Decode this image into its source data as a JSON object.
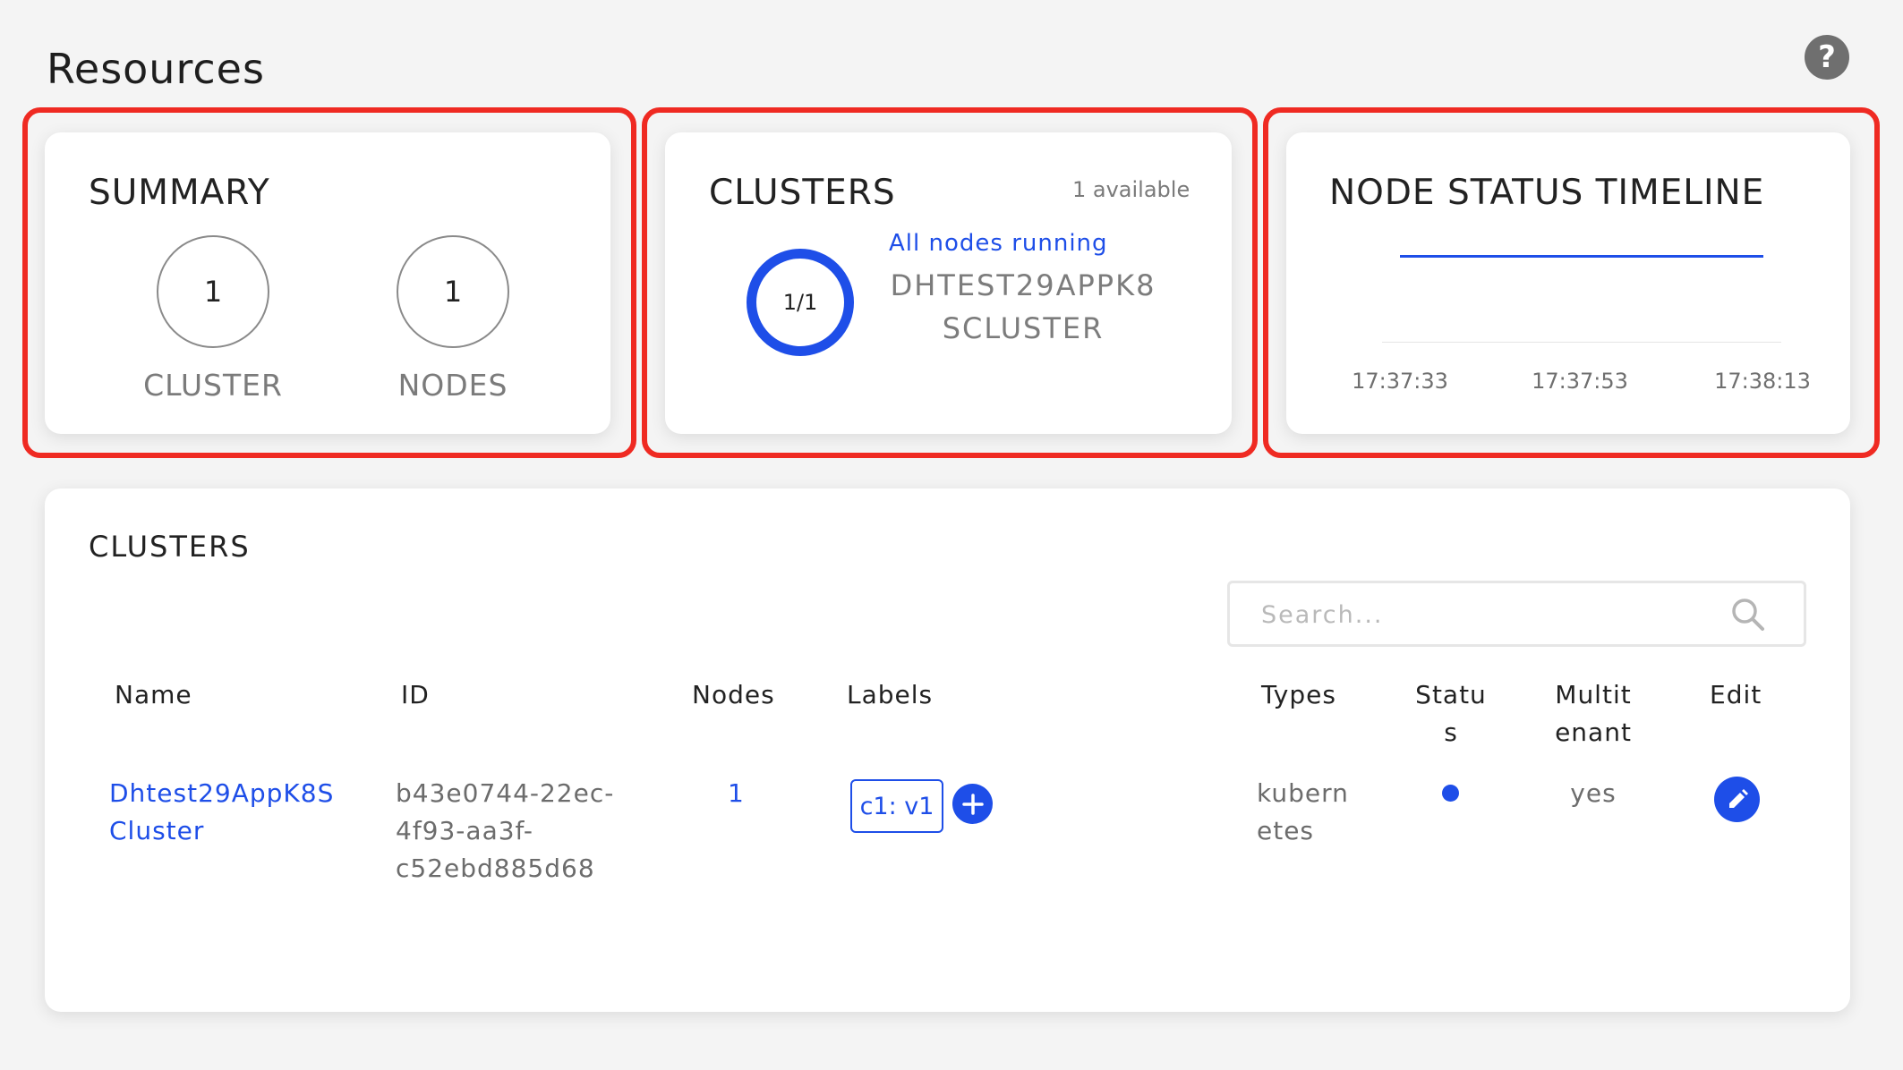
{
  "page": {
    "title": "Resources"
  },
  "summary": {
    "heading": "SUMMARY",
    "cluster_count": "1",
    "cluster_label": "CLUSTER",
    "nodes_count": "1",
    "nodes_label": "NODES"
  },
  "clusters_card": {
    "heading": "CLUSTERS",
    "available": "1 available",
    "ring_value": "1/1",
    "ring_progress": 1.0,
    "status_text": "All nodes running",
    "cluster_name_line1": "DHTEST29APPK8",
    "cluster_name_line2": "SCLUSTER"
  },
  "timeline": {
    "heading": "NODE STATUS TIMELINE",
    "ticks": [
      "17:37:33",
      "17:37:53",
      "17:38:13"
    ]
  },
  "clusters_table": {
    "title": "CLUSTERS",
    "search_placeholder": "Search...",
    "columns": {
      "name": "Name",
      "id": "ID",
      "nodes": "Nodes",
      "labels": "Labels",
      "types": "Types",
      "status_l1": "Statu",
      "status_l2": "s",
      "multitenant_l1": "Multit",
      "multitenant_l2": "enant",
      "edit": "Edit"
    },
    "rows": [
      {
        "name_l1": "Dhtest29AppK8S",
        "name_l2": "Cluster",
        "id_l1": "b43e0744-22ec-",
        "id_l2": "4f93-aa3f-",
        "id_l3": "c52ebd885d68",
        "nodes": "1",
        "label": "c1: v1",
        "type_l1": "kubern",
        "type_l2": "etes",
        "status": "running",
        "multitenant": "yes"
      }
    ]
  },
  "colors": {
    "accent": "#1e4ee8",
    "highlight": "#ef2a22"
  }
}
